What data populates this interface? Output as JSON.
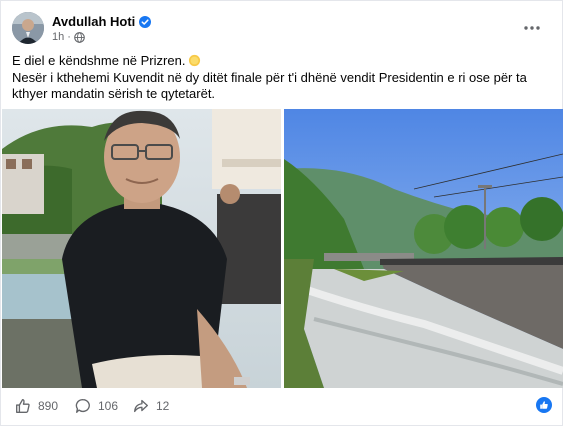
{
  "post": {
    "author": "Avdullah Hoti",
    "time": "1h",
    "separator": "·",
    "line1": "E diel e këndshme në Prizren.",
    "line2": "Nesër i kthehemi Kuvendit në dy ditët finale për t'i dhënë vendit Presidentin e ri ose për ta kthyer mandatin sërish te qytetarët."
  },
  "stats": {
    "likes": "890",
    "comments": "106",
    "shares": "12"
  },
  "icons": {
    "avatar": "profile-photo",
    "verified": "verified-badge-icon",
    "globe": "globe-icon",
    "more": "more-dots-icon",
    "sun": "sun-emoji-icon",
    "like": "thumbs-up-icon",
    "comment": "comment-bubble-icon",
    "share": "share-arrow-icon",
    "like_badge": "like-reaction-badge-icon"
  },
  "colors": {
    "accent": "#1877f2",
    "muted_text": "#65676b",
    "text": "#050505"
  }
}
